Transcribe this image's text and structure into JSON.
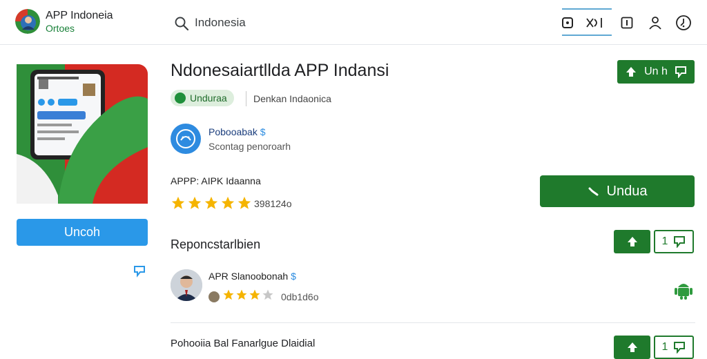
{
  "header": {
    "app_name": "APP Indoneia",
    "app_sub": "Ortoes",
    "search_value": "Indonesia"
  },
  "app": {
    "title": "Ndonesaiartllda APP Indansi",
    "chip_label": "Unduraa",
    "category": "Denkan Indaonica",
    "developer_name": "Pobooabak",
    "developer_verified": "$",
    "developer_sub": "Scontag penoroarh",
    "apk_label": "APPP: AIPK Idaanna",
    "rating_stars": 5,
    "rating_count": "398124o",
    "left_button_label": "Uncoh",
    "main_button_label": "Undua",
    "top_action_label": "Un h",
    "section_action_label": "1",
    "footer_action_label": "1"
  },
  "reviews": {
    "section_title": "Reponcstarlbien",
    "reviewer_name": "APR Slanoobonah",
    "reviewer_verified": "$",
    "reviewer_stars": 3,
    "reviewer_count": "0db1d6o"
  },
  "footer": {
    "text": "Pohooiia Bal Fanarlgue Dlaidial"
  },
  "colors": {
    "green": "#1f7a2c",
    "blue": "#2a98e8",
    "star": "#f5b400"
  }
}
